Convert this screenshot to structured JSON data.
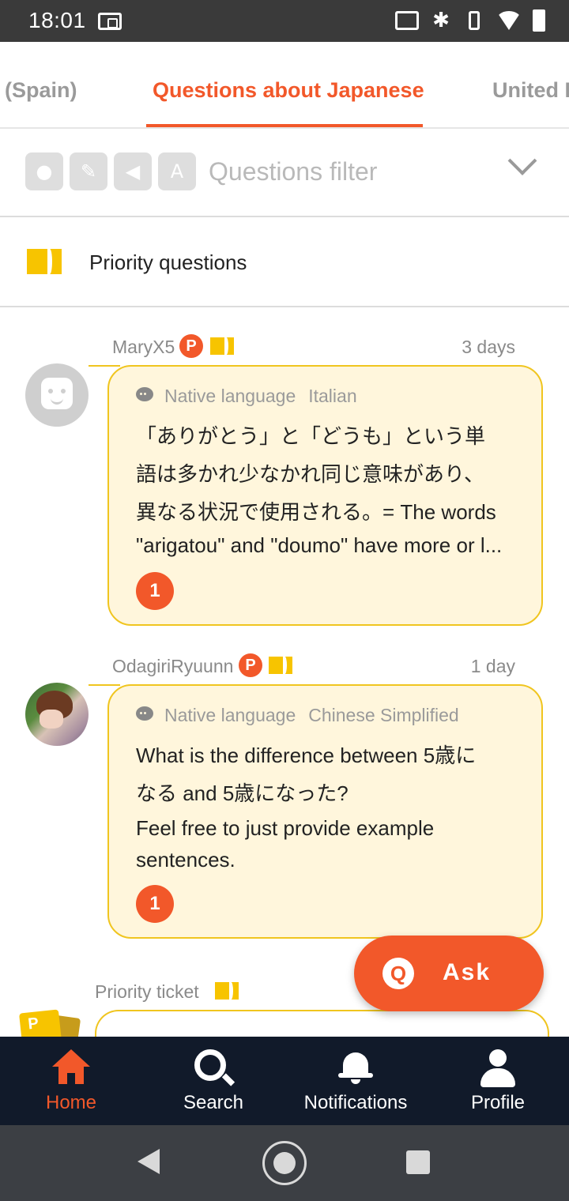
{
  "status_bar": {
    "time": "18:01"
  },
  "tabs": {
    "left": "(Spain)",
    "active": "Questions about Japanese",
    "right": "United K"
  },
  "filter": {
    "label": "Questions filter",
    "icons": [
      "speech-bubble-icon",
      "pencil-icon",
      "speaker-icon",
      "audio-translate-icon"
    ]
  },
  "priority": {
    "label": "Priority questions"
  },
  "questions": [
    {
      "user": "MaryX5",
      "badge": "P",
      "time": "3 days",
      "lang_label": "Native language",
      "lang_value": "Italian",
      "text_lines": [
        "「ありがとう」と「どうも」という単",
        "語は多かれ少なかれ同じ意味があり、",
        "異なる状況で使用される。= The words",
        "\"arigatou\" and \"doumo\" have more or l..."
      ],
      "answers": "1"
    },
    {
      "user": "OdagiriRyuunn",
      "badge": "P",
      "time": "1 day",
      "lang_label": "Native language",
      "lang_value": "Chinese Simplified",
      "text_lines": [
        "What is the difference between 5歳に",
        "なる and 5歳になった?",
        "Feel free to just provide example",
        "sentences."
      ],
      "answers": "1"
    }
  ],
  "third": {
    "label": "Priority ticket",
    "stack_letter": "P"
  },
  "fab": {
    "icon": "Q",
    "label": "Ask"
  },
  "bottom_nav": {
    "home": "Home",
    "search": "Search",
    "notifications": "Notifications",
    "profile": "Profile"
  },
  "colors": {
    "accent": "#f2582a",
    "ticket": "#f7c400",
    "bubble": "#fff6dc",
    "nav_bg": "#111a2a"
  }
}
